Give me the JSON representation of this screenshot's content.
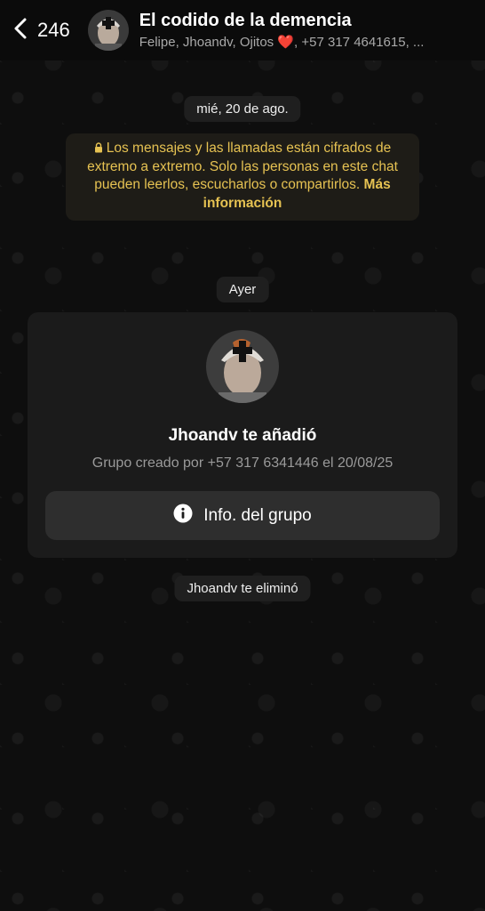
{
  "header": {
    "back_count": "246",
    "title": "El codido de la demencia",
    "subtitle_prefix": "Felipe, Jhoandv, Ojitos ",
    "subtitle_heart": "❤️",
    "subtitle_suffix": ", +57 317 4641615, ..."
  },
  "chat": {
    "date_chip": "mié, 20 de ago.",
    "encryption_text": "Los mensajes y las llamadas están cifrados de extremo a extremo. Solo las personas en este chat pueden leerlos, escucharlos o compartirlos. ",
    "encryption_link": "Más información",
    "day_chip": "Ayer",
    "group_card": {
      "title": "Jhoandv te añadió",
      "subtitle": "Grupo creado por +57 317 6341446 el 20/08/25",
      "button_label": "Info. del grupo"
    },
    "removed_chip": "Jhoandv te eliminó"
  },
  "colors": {
    "accent_yellow": "#e6c252",
    "heart": "#e0203a"
  },
  "icons": {
    "back": "chevron-left-icon",
    "lock": "lock-icon",
    "info": "info-icon"
  }
}
